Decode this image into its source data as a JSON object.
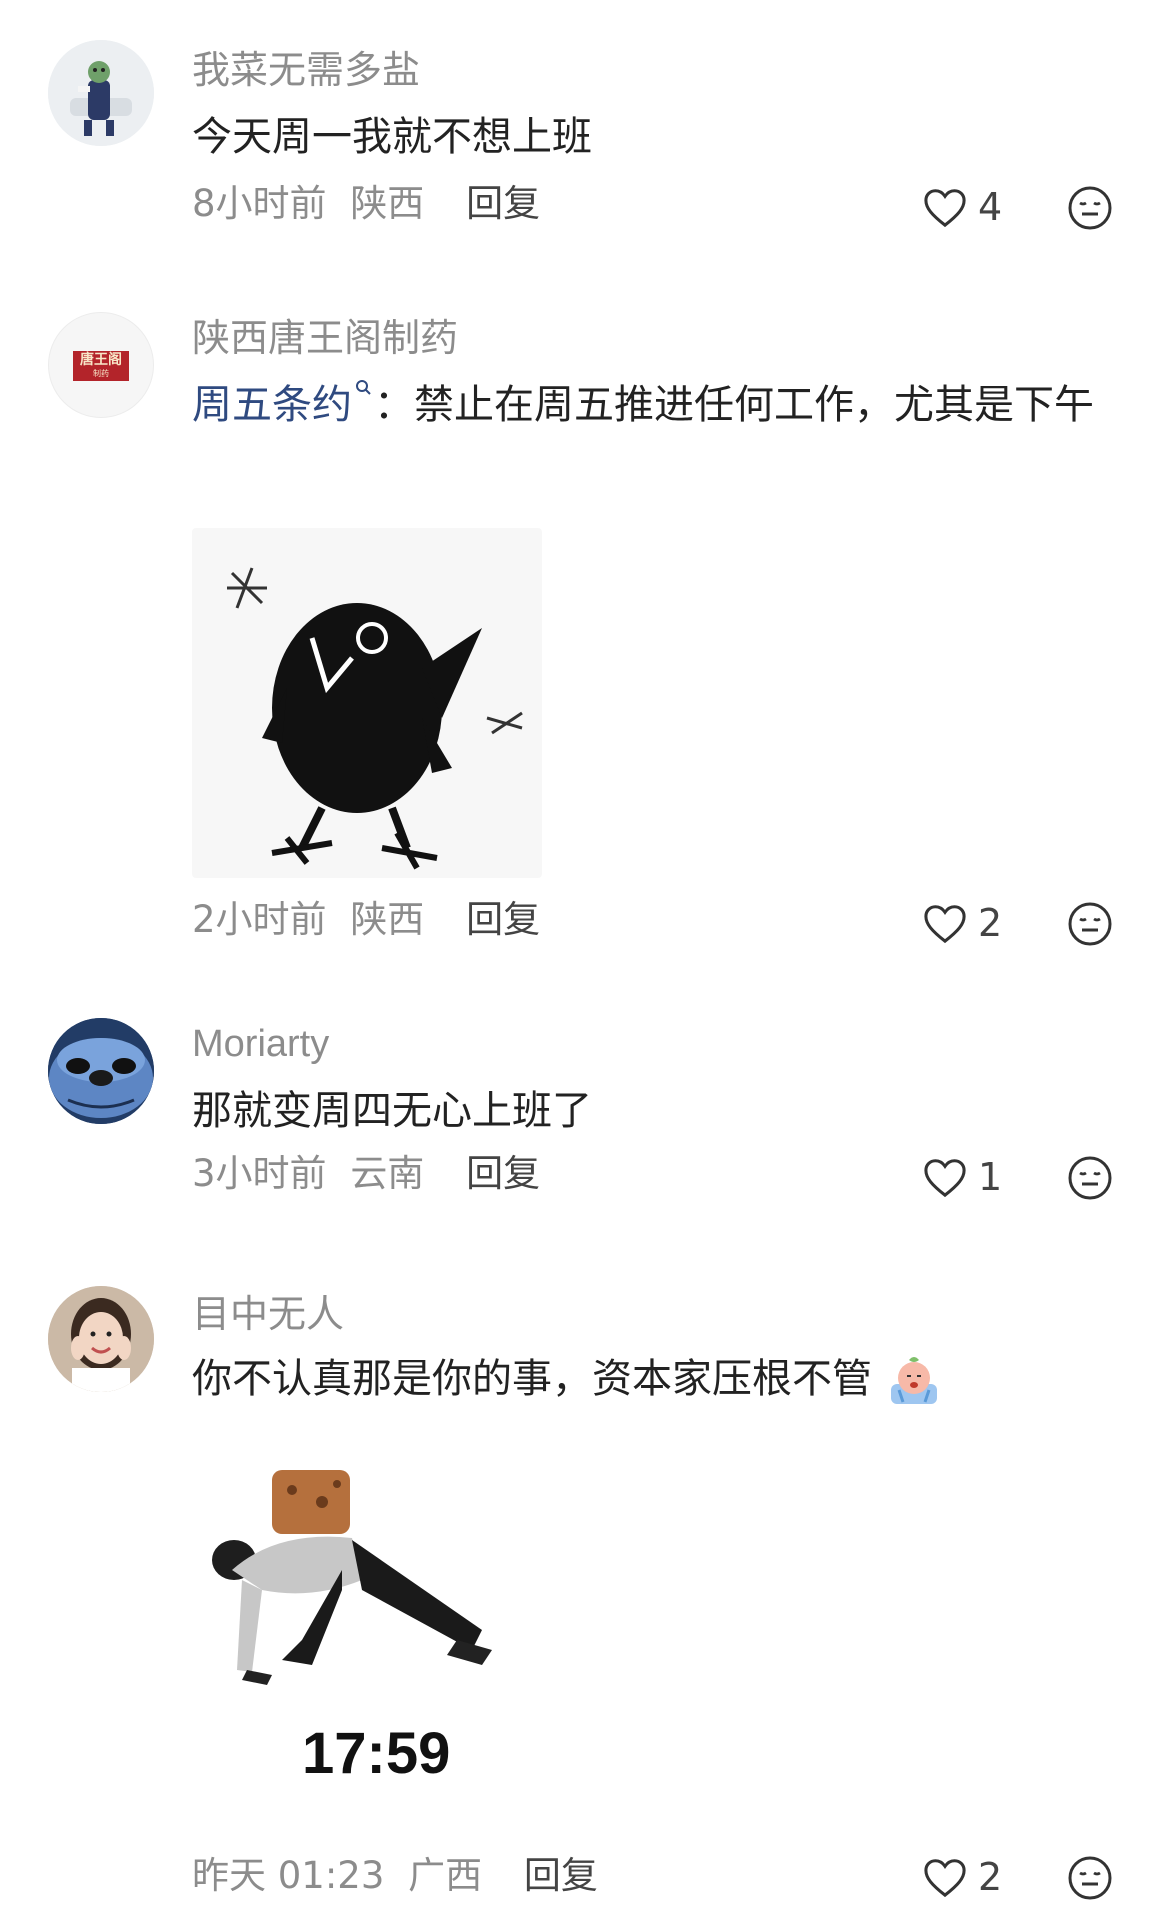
{
  "comments": [
    {
      "username": "我菜无需多盐",
      "text": "今天周一我就不想上班",
      "time": "8小时前",
      "location": "陕西",
      "reply_label": "回复",
      "likes": "4"
    },
    {
      "username": "陕西唐王阁制药",
      "avatar_text": "唐王阁",
      "avatar_subtext": "制药",
      "mention": "周五条约",
      "text": "：禁止在周五推进任何工作，尤其是下午",
      "time": "2小时前",
      "location": "陕西",
      "reply_label": "回复",
      "likes": "2"
    },
    {
      "username": "Moriarty",
      "text": "那就变周四无心上班了",
      "time": "3小时前",
      "location": "云南",
      "reply_label": "回复",
      "likes": "1"
    },
    {
      "username": "目中无人",
      "text": "你不认真那是你的事，资本家压根不管",
      "sticker_text": "17:59",
      "time": "昨天 01:23",
      "location": "广西",
      "reply_label": "回复",
      "likes": "2"
    }
  ],
  "colors": {
    "mention": "#2f4a80",
    "meta": "#8c8c8c",
    "brand_red": "#b3242a"
  },
  "icons": {
    "like": "heart-outline-icon",
    "emoji": "neutral-face-icon",
    "search": "search-icon"
  }
}
